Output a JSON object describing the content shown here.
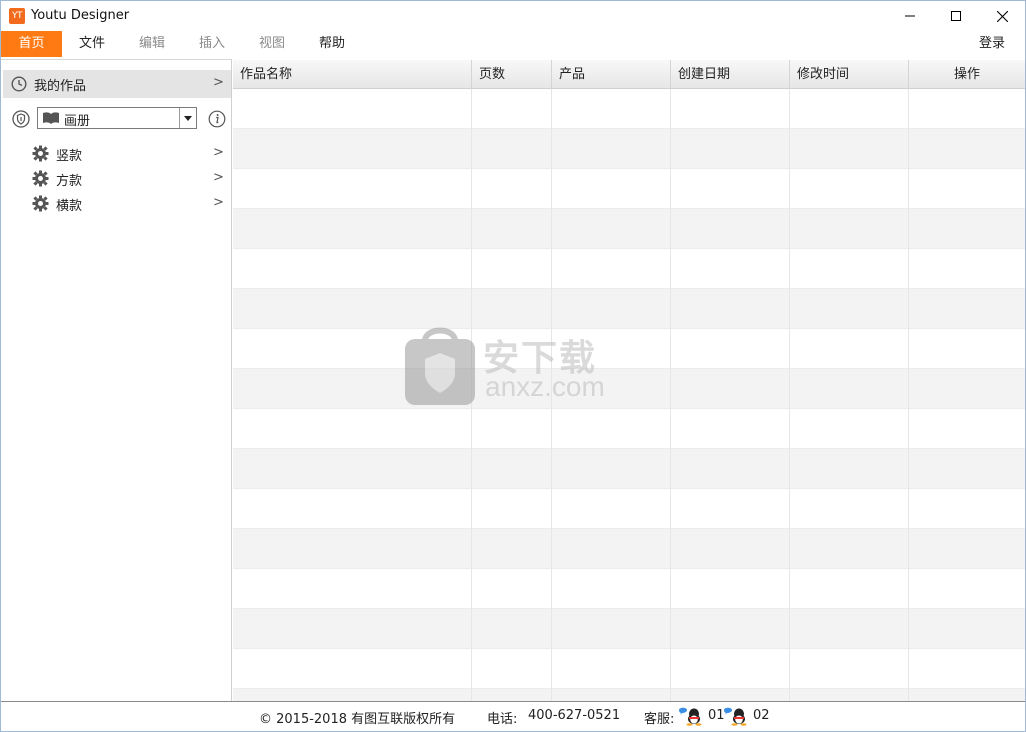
{
  "window": {
    "title": "Youtu Designer",
    "logo_text": "YT"
  },
  "menubar": {
    "items": [
      {
        "label": "首页",
        "state": "active"
      },
      {
        "label": "文件",
        "state": "enabled"
      },
      {
        "label": "编辑",
        "state": "disabled"
      },
      {
        "label": "插入",
        "state": "disabled"
      },
      {
        "label": "视图",
        "state": "disabled"
      },
      {
        "label": "帮助",
        "state": "enabled"
      }
    ],
    "login_label": "登录",
    "accent_color": "#ff7a12"
  },
  "sidebar": {
    "my_works_label": "我的作品",
    "type_select": {
      "value": "画册"
    },
    "sub_items": [
      {
        "label": "竖款"
      },
      {
        "label": "方款"
      },
      {
        "label": "横款"
      }
    ]
  },
  "table": {
    "columns": [
      "作品名称",
      "页数",
      "产品",
      "创建日期",
      "修改时间",
      "操作"
    ],
    "rows": []
  },
  "watermark": {
    "cn_text": "安下载",
    "en_text": "anxz.com"
  },
  "footer": {
    "copyright": "© 2015-2018 有图互联版权所有",
    "phone_label": "电话:",
    "phone_value": "400-627-0521",
    "service_label": "客服:",
    "qq_1": "01",
    "qq_2": "02"
  }
}
